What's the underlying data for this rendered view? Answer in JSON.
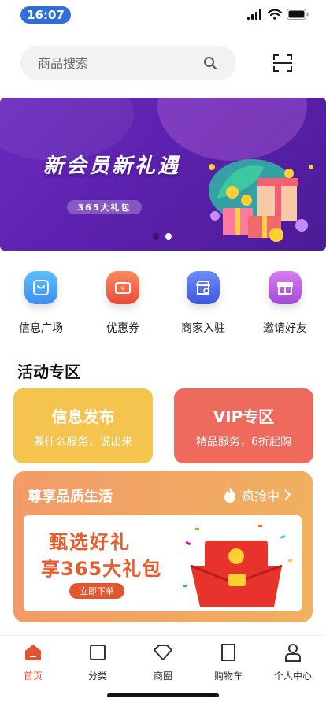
{
  "status_bar": {
    "time": "16:07"
  },
  "search": {
    "placeholder": "商品搜索"
  },
  "banner": {
    "title": "新会员新礼遇",
    "tag": "365大礼包",
    "dots": 2,
    "active_dot": 1
  },
  "shortcuts": [
    {
      "label": "信息广场",
      "icon": "message-square-icon",
      "color": "#4aa8f2"
    },
    {
      "label": "优惠券",
      "icon": "coupon-icon",
      "color": "#f05a3a"
    },
    {
      "label": "商家入驻",
      "icon": "store-icon",
      "color": "#4f6ef0"
    },
    {
      "label": "邀请好友",
      "icon": "gift-icon",
      "color": "#b55fe0"
    }
  ],
  "activity": {
    "title": "活动专区",
    "cards": [
      {
        "title": "信息发布",
        "subtitle": "要什么服务，说出来",
        "color": "#f4c44e"
      },
      {
        "title": "VIP专区",
        "subtitle": "精品服务，6折起购",
        "color": "#ee6a5c"
      }
    ],
    "life": {
      "title": "尊享品质生活",
      "rush": "疯抢中",
      "headline1": "甄选好礼",
      "headline2": "享365大礼包",
      "button": "立即下单"
    }
  },
  "tabbar": {
    "active_color": "#e2552f",
    "items": [
      {
        "label": "首页",
        "icon": "home-icon",
        "active": true
      },
      {
        "label": "分类",
        "icon": "category-icon",
        "active": false
      },
      {
        "label": "商圈",
        "icon": "diamond-icon",
        "active": false
      },
      {
        "label": "购物车",
        "icon": "cart-icon",
        "active": false
      },
      {
        "label": "个人中心",
        "icon": "user-icon",
        "active": false
      }
    ]
  }
}
